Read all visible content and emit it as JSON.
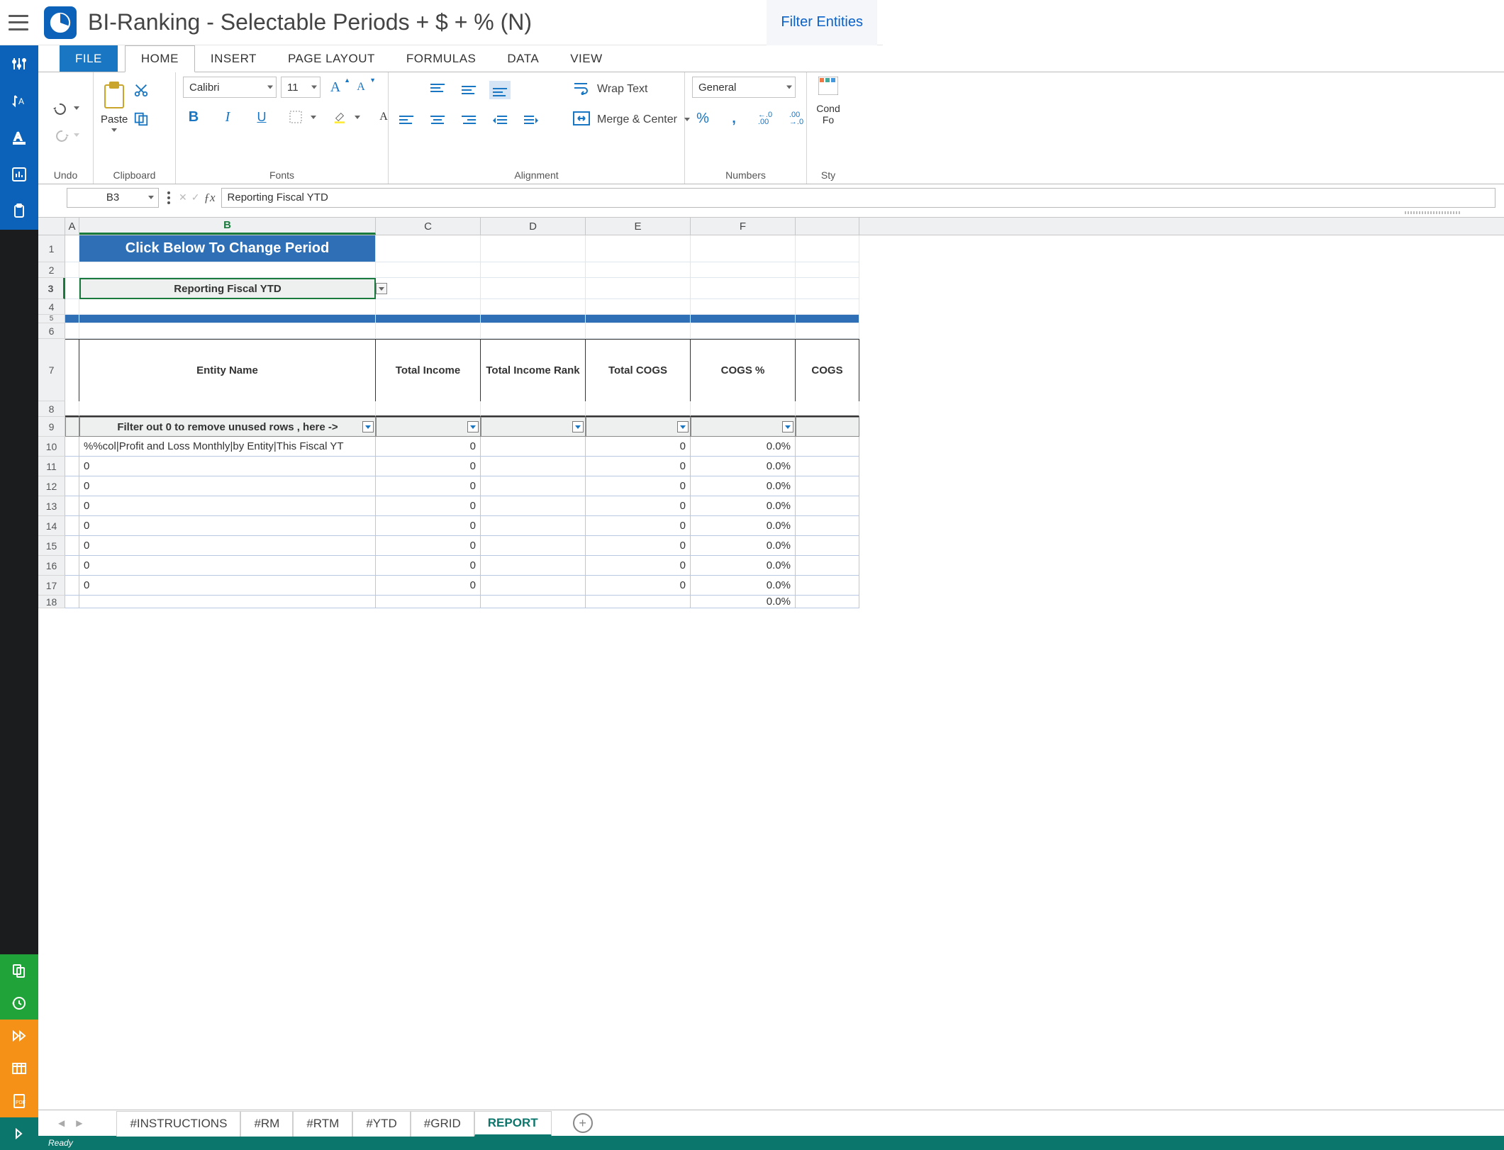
{
  "title": "BI-Ranking - Selectable Periods + $ + % (N)",
  "filter_entities": "Filter Entities",
  "ribbon_tabs": {
    "file": "FILE",
    "home": "HOME",
    "insert": "INSERT",
    "page": "PAGE LAYOUT",
    "formulas": "FORMULAS",
    "data": "DATA",
    "view": "VIEW"
  },
  "ribbon_groups": {
    "undo": "Undo",
    "clipboard": "Clipboard",
    "fonts": "Fonts",
    "alignment": "Alignment",
    "numbers": "Numbers",
    "styles": "Sty"
  },
  "clipboard": {
    "paste": "Paste"
  },
  "font": {
    "name": "Calibri",
    "size": "11"
  },
  "alignment": {
    "wrap": "Wrap Text",
    "merge": "Merge & Center"
  },
  "number_format": "General",
  "cond_format": "Cond Fo",
  "name_box": "B3",
  "formula_value": "Reporting Fiscal YTD",
  "columns": {
    "A": "A",
    "B": "B",
    "C": "C",
    "D": "D",
    "E": "E",
    "F": "F"
  },
  "banner": "Click Below To Change Period",
  "period_value": "Reporting Fiscal YTD",
  "headers": {
    "entity": "Entity Name",
    "income": "Total Income",
    "income_rank": "Total Income Rank",
    "cogs": "Total COGS",
    "cogs_pct": "COGS %",
    "cogs_next": "COGS"
  },
  "filter_hint": "Filter out 0 to remove unused rows , here ->",
  "rows": [
    {
      "n": 10,
      "b": "%%col|Profit and Loss Monthly|by Entity|This Fiscal YT",
      "c": "0",
      "d": "",
      "e": "0",
      "f": "0.0%"
    },
    {
      "n": 11,
      "b": "0",
      "c": "0",
      "d": "",
      "e": "0",
      "f": "0.0%"
    },
    {
      "n": 12,
      "b": "0",
      "c": "0",
      "d": "",
      "e": "0",
      "f": "0.0%"
    },
    {
      "n": 13,
      "b": "0",
      "c": "0",
      "d": "",
      "e": "0",
      "f": "0.0%"
    },
    {
      "n": 14,
      "b": "0",
      "c": "0",
      "d": "",
      "e": "0",
      "f": "0.0%"
    },
    {
      "n": 15,
      "b": "0",
      "c": "0",
      "d": "",
      "e": "0",
      "f": "0.0%"
    },
    {
      "n": 16,
      "b": "0",
      "c": "0",
      "d": "",
      "e": "0",
      "f": "0.0%"
    },
    {
      "n": 17,
      "b": "0",
      "c": "0",
      "d": "",
      "e": "0",
      "f": "0.0%"
    },
    {
      "n": 18,
      "b": "",
      "c": "",
      "d": "",
      "e": "",
      "f": "0.0%"
    }
  ],
  "sheet_tabs": {
    "t1": "#INSTRUCTIONS",
    "t2": "#RM",
    "t3": "#RTM",
    "t4": "#YTD",
    "t5": "#GRID",
    "t6": "REPORT"
  },
  "status": "Ready"
}
